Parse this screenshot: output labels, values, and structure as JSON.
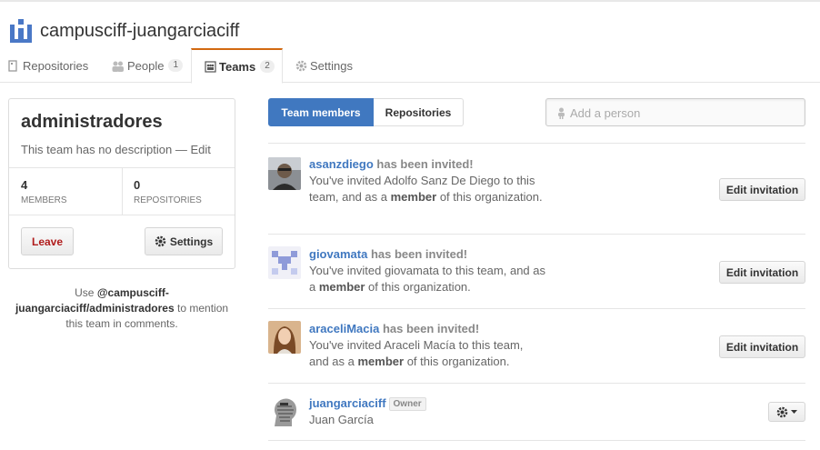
{
  "org": {
    "name": "campusciff-juangarciaciff"
  },
  "tabs": [
    {
      "label": "Repositories",
      "count": null
    },
    {
      "label": "People",
      "count": "1"
    },
    {
      "label": "Teams",
      "count": "2"
    },
    {
      "label": "Settings",
      "count": null
    }
  ],
  "team": {
    "name": "administradores",
    "description": "This team has no description",
    "separator": " — ",
    "edit_label": "Edit",
    "stats": [
      {
        "value": "4",
        "label": "Members"
      },
      {
        "value": "0",
        "label": "Repositories"
      }
    ],
    "leave_label": "Leave",
    "settings_label": "Settings",
    "mention_prefix": "Use ",
    "mention_handle": "@campusciff-juangarciaciff/administradores",
    "mention_suffix": " to mention this team in comments."
  },
  "segmented": {
    "members_label": "Team members",
    "repos_label": "Repositories"
  },
  "add_person": {
    "placeholder": "Add a person"
  },
  "members": [
    {
      "username": "asanzdiego",
      "status": "has been invited!",
      "text_pre": "You've invited Adolfo Sanz De Diego to this team, and as a ",
      "role": "member",
      "text_post": " of this organization.",
      "button": "Edit invitation"
    },
    {
      "username": "giovamata",
      "status": "has been invited!",
      "text_pre": "You've invited giovamata to this team, and as a ",
      "role": "member",
      "text_post": " of this organization.",
      "button": "Edit invitation"
    },
    {
      "username": "araceliMacia",
      "status": "has been invited!",
      "text_pre": "You've invited Araceli Macía to this team, and as a ",
      "role": "member",
      "text_post": " of this organization.",
      "button": "Edit invitation"
    }
  ],
  "owner_member": {
    "username": "juangarciaciff",
    "badge": "Owner",
    "full_name": "Juan García"
  },
  "colors": {
    "accent": "#4078c0",
    "tab_highlight": "#d26911",
    "danger": "#b01b1b"
  }
}
